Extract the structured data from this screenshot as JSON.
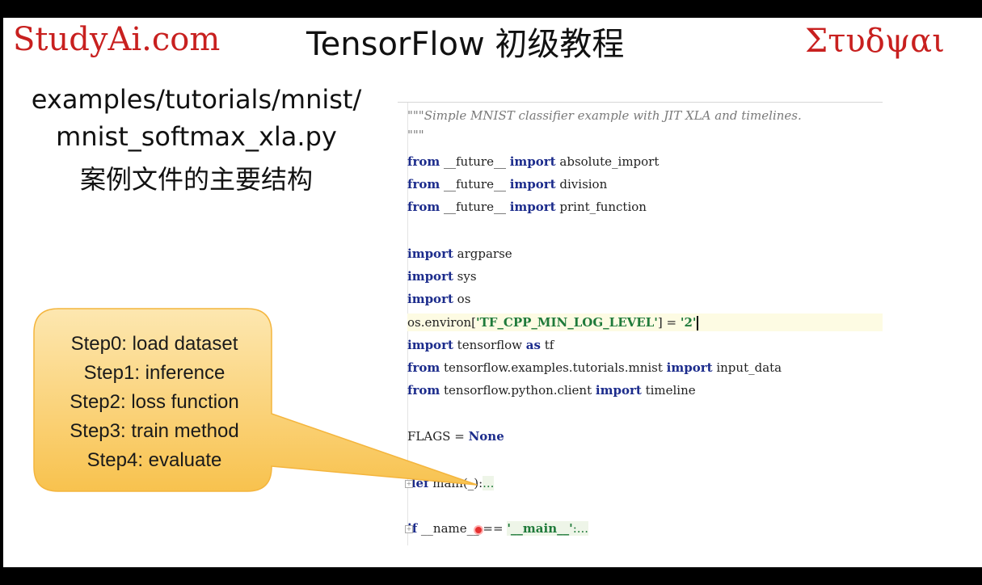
{
  "header": {
    "logo_left": "StudyAi.com",
    "title": "TensorFlow 初级教程",
    "logo_right": "Στυδψαι"
  },
  "file": {
    "line1": "examples/tutorials/mnist/",
    "line2": "mnist_softmax_xla.py",
    "line3": "案例文件的主要结构"
  },
  "callout": {
    "steps": [
      "Step0: load dataset",
      "Step1:  inference",
      "Step2: loss function",
      "Step3: train method",
      "Step4: evaluate"
    ]
  },
  "code": {
    "doc1": "\"\"\"Simple MNIST classifier example with JIT XLA and timelines.",
    "doc2": "\"\"\"",
    "from_kw": "from",
    "import_kw": "import",
    "future": " __future__ ",
    "absolute_import": " absolute_import",
    "division": " division",
    "print_function": " print_function",
    "argparse": " argparse",
    "sys": " sys",
    "os": " os",
    "environ_pre": "os.environ[",
    "env_key": "'TF_CPP_MIN_LOG_LEVEL'",
    "environ_mid": "] = ",
    "env_val": "'2'",
    "tensorflow": " tensorflow ",
    "as_kw": "as",
    "tf": " tf",
    "mnist_mod": " tensorflow.examples.tutorials.mnist ",
    "input_data": " input_data",
    "client_mod": " tensorflow.python.client ",
    "timeline": " timeline",
    "flags_pre": "FLAGS = ",
    "none_kw": "None",
    "def_kw": "def",
    "main_sig": " main(_):",
    "ellipsis": "...",
    "if_kw": "if",
    "name_cmp": " __name__ == ",
    "main_str": "'__main__'",
    "colon": ":"
  }
}
